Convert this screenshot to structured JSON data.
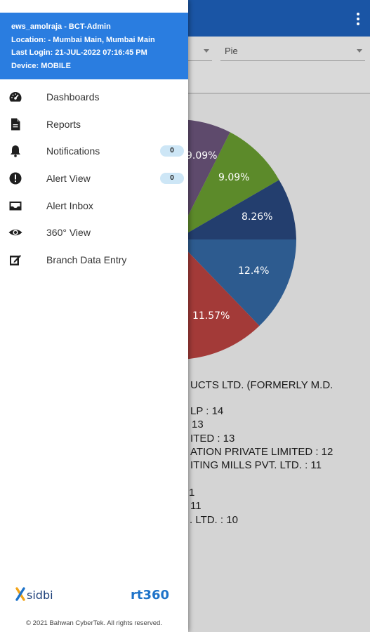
{
  "header": {
    "user": "ews_amolraja - BCT-Admin",
    "location": "Location: - Mumbai Main, Mumbai Main",
    "last_login": "Last Login: 21-JUL-2022 07:16:45 PM",
    "device": "Device: MOBILE"
  },
  "menu": [
    {
      "label": "Dashboards",
      "icon": "dashboard-icon"
    },
    {
      "label": "Reports",
      "icon": "document-icon"
    },
    {
      "label": "Notifications",
      "icon": "bell-icon",
      "badge": "0"
    },
    {
      "label": "Alert View",
      "icon": "alert-icon",
      "badge": "0"
    },
    {
      "label": "Alert Inbox",
      "icon": "inbox-icon"
    },
    {
      "label": "360° View",
      "icon": "eye-icon"
    },
    {
      "label": "Branch Data Entry",
      "icon": "edit-icon"
    }
  ],
  "footer": {
    "sidbi_logo": "sidbi",
    "rt360_logo": "rt360",
    "copyright": "© 2021 Bahwan CyberTek. All rights reserved."
  },
  "filters": {
    "chart_type": "Pie"
  },
  "chart_data": {
    "type": "pie",
    "slices": [
      {
        "label": "9.09%",
        "color": "#5e4a6c"
      },
      {
        "label": "9.09%",
        "color": "#5c8a2a"
      },
      {
        "label": "8.26%",
        "color": "#233e6e"
      },
      {
        "label": "12.4%",
        "color": "#2d5b8f"
      },
      {
        "label": "11.57%",
        "color": "#a33a38"
      }
    ]
  },
  "legend_lines": [
    "UCTS LTD. (FORMERLY M.D.",
    "LP : 14",
    "13",
    "ITED : 13",
    "ATION PRIVATE LIMITED : 12",
    "ITING MILLS PVT. LTD. : 11",
    "1",
    "11",
    ". LTD. : 10"
  ],
  "colors": {
    "topbar": "#1a55a5",
    "drawer_header": "#2a7de0",
    "badge": "#cde6f6"
  }
}
